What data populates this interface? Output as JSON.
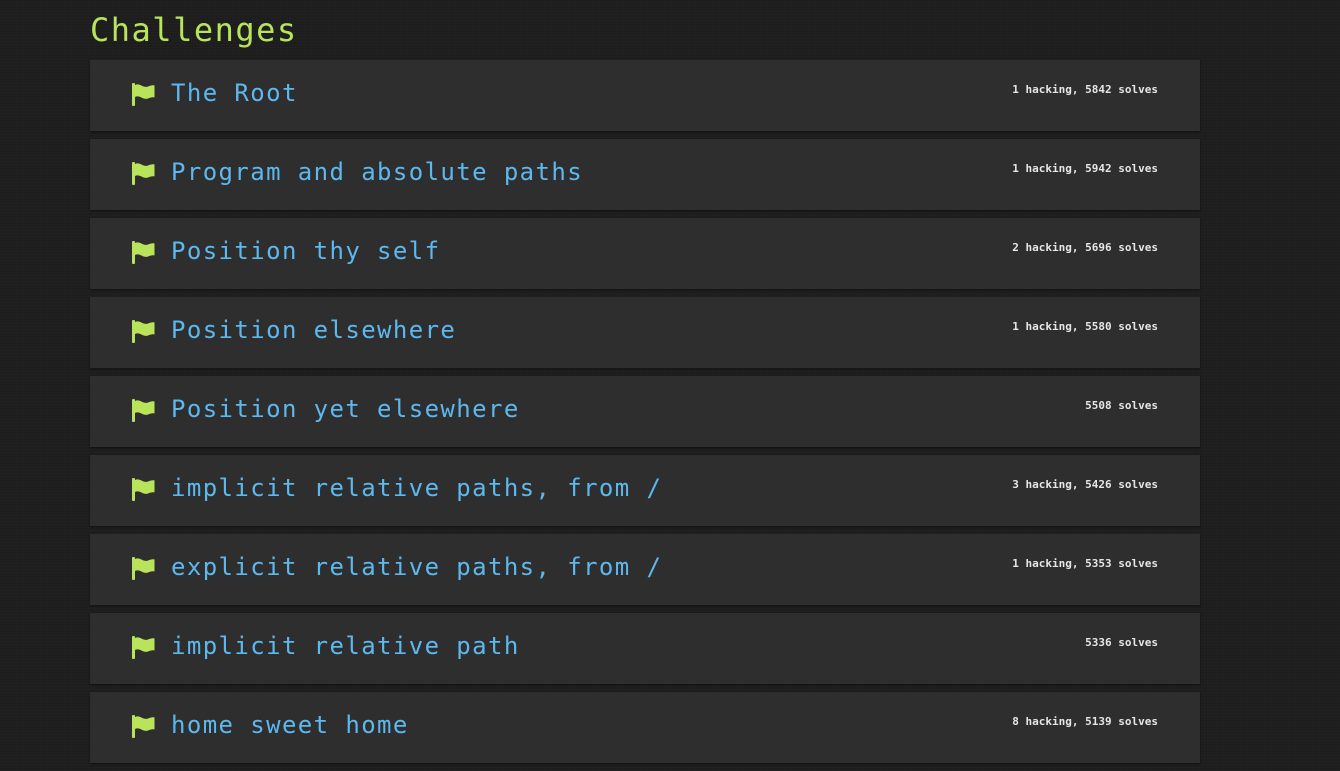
{
  "page": {
    "title": "Challenges"
  },
  "colors": {
    "background": "#1e1e1e",
    "row_background": "#2e2e2e",
    "title": "#b8e35a",
    "flag": "#b8e35a",
    "challenge_name": "#5cb8ee",
    "stats": "#e6e6e6"
  },
  "challenges": [
    {
      "icon": "flag-icon",
      "name": "The Root",
      "stats": "1 hacking, 5842 solves"
    },
    {
      "icon": "flag-icon",
      "name": "Program and absolute paths",
      "stats": "1 hacking, 5942 solves"
    },
    {
      "icon": "flag-icon",
      "name": "Position thy self",
      "stats": "2 hacking, 5696 solves"
    },
    {
      "icon": "flag-icon",
      "name": "Position elsewhere",
      "stats": "1 hacking, 5580 solves"
    },
    {
      "icon": "flag-icon",
      "name": "Position yet elsewhere",
      "stats": "5508 solves"
    },
    {
      "icon": "flag-icon",
      "name": "implicit relative paths, from /",
      "stats": "3 hacking, 5426 solves"
    },
    {
      "icon": "flag-icon",
      "name": "explicit relative paths, from /",
      "stats": "1 hacking, 5353 solves"
    },
    {
      "icon": "flag-icon",
      "name": "implicit relative path",
      "stats": "5336 solves"
    },
    {
      "icon": "flag-icon",
      "name": "home sweet home",
      "stats": "8 hacking, 5139 solves"
    }
  ]
}
